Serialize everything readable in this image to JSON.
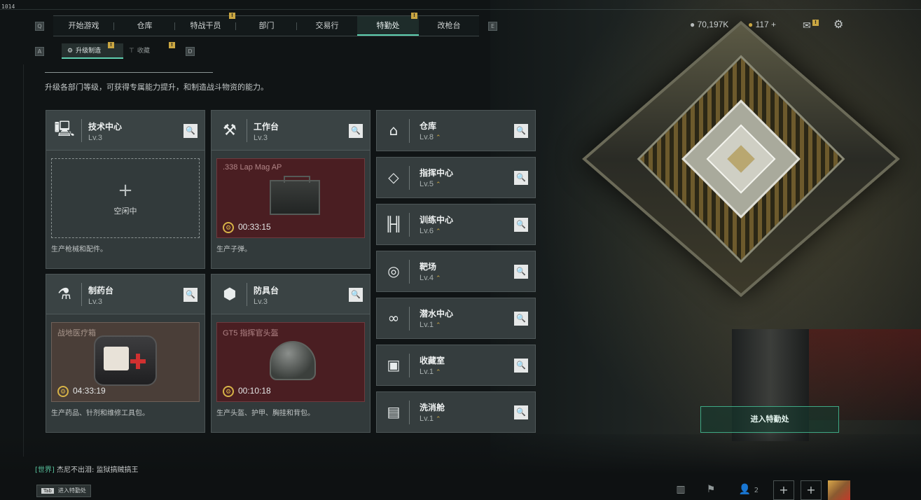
{
  "debug_label": "1014",
  "top_tabs": [
    {
      "label": "开始游戏",
      "active": false
    },
    {
      "label": "仓库",
      "active": false
    },
    {
      "label": "特战干员",
      "active": false,
      "badge": "!"
    },
    {
      "label": "部门",
      "active": false
    },
    {
      "label": "交易行",
      "active": false
    },
    {
      "label": "特勤处",
      "active": true,
      "badge": "!"
    },
    {
      "label": "改枪台",
      "active": false
    }
  ],
  "keycaps": {
    "left": "Q",
    "right": "E",
    "sub_left": "A",
    "sub_right": "D"
  },
  "sub_tabs": [
    {
      "label": "升级制造",
      "icon": "gear-upgrade-icon",
      "active": true
    },
    {
      "label": "收藏",
      "icon": "collection-icon",
      "active": false,
      "badge": "!"
    }
  ],
  "currency": {
    "coins": "70,197K",
    "tokens": "117 +"
  },
  "description": "升级各部门等级，可获得专属能力提升，和制造战斗物资的能力。",
  "facilities": [
    {
      "name": "技术中心",
      "level": "Lv.3",
      "icon": "computer-icon",
      "state": "idle",
      "idle_text": "空闲中",
      "footer": "生产枪械和配件。"
    },
    {
      "name": "工作台",
      "level": "Lv.3",
      "icon": "tools-icon",
      "state": "producing",
      "product": ".338 Lap Mag AP",
      "timer": "00:33:15",
      "footer": "生产子弹。",
      "tint": "red"
    },
    {
      "name": "制药台",
      "level": "Lv.3",
      "icon": "microscope-icon",
      "state": "producing",
      "product": "战地医疗箱",
      "timer": "04:33:19",
      "footer": "生产药品、针剂和维修工具包。",
      "tint": "brown"
    },
    {
      "name": "防具台",
      "level": "Lv.3",
      "icon": "cubes-icon",
      "state": "producing",
      "product": "GT5 指挥官头盔",
      "timer": "00:10:18",
      "footer": "生产头盔、护甲、胸挂和背包。",
      "tint": "red"
    }
  ],
  "side_facilities": [
    {
      "name": "仓库",
      "level": "Lv.8",
      "icon": "warehouse-icon"
    },
    {
      "name": "指挥中心",
      "level": "Lv.5",
      "icon": "command-diamond-icon"
    },
    {
      "name": "训练中心",
      "level": "Lv.6",
      "icon": "dumbbell-icon"
    },
    {
      "name": "靶场",
      "level": "Lv.4",
      "icon": "target-icon"
    },
    {
      "name": "潜水中心",
      "level": "Lv.1",
      "icon": "diving-mask-icon"
    },
    {
      "name": "收藏室",
      "level": "Lv.1",
      "icon": "collection-room-icon"
    },
    {
      "name": "洗消舱",
      "level": "Lv.1",
      "icon": "decon-chamber-icon"
    }
  ],
  "enter_button": "进入特勤处",
  "chat": {
    "channel": "[世界]",
    "sender": "杰尼不出泪",
    "message": "监狱搞贼搞王"
  },
  "tab_hint": {
    "key": "Tab",
    "label": "进入特勤处"
  },
  "party_count": "2",
  "colors": {
    "accent": "#5fd0b0",
    "badge": "#c9a642",
    "red_panel": "#4a1e22",
    "brown_panel": "#4a3e38"
  }
}
